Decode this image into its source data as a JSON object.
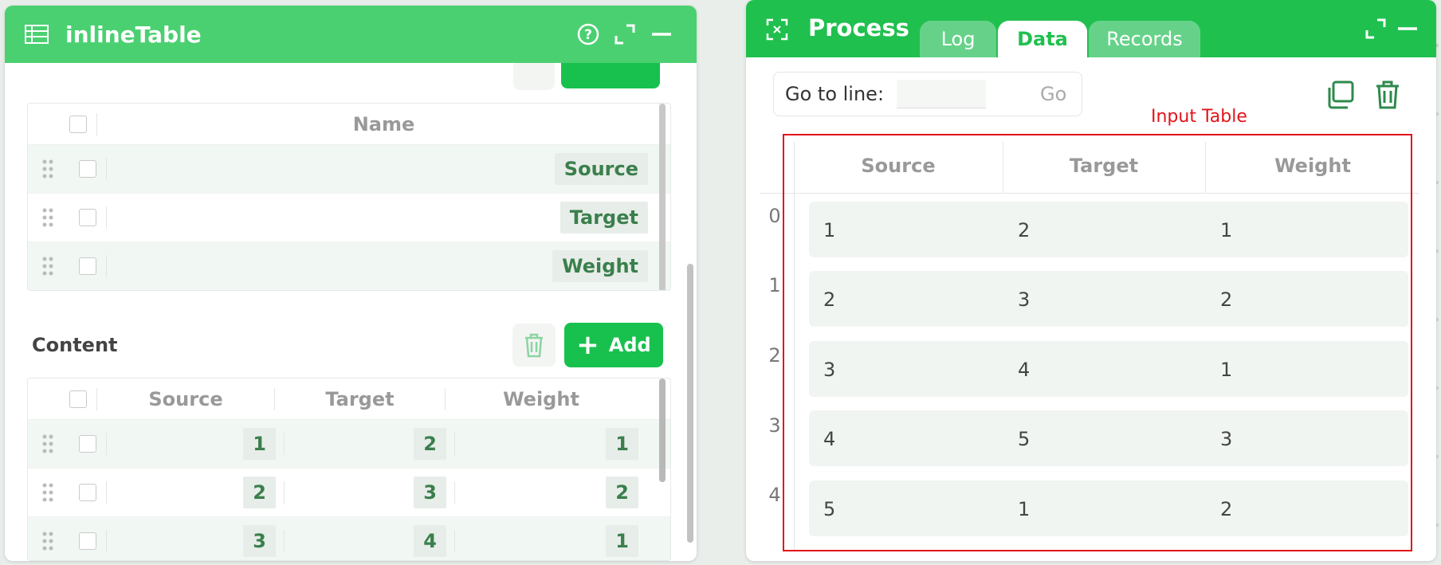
{
  "left_panel": {
    "title": "inlineTable",
    "colors": {
      "header_bg": "#4bd071",
      "accent": "#18c14d"
    },
    "columns_list": {
      "header": "Name",
      "items": [
        "Source",
        "Target",
        "Weight"
      ]
    },
    "content": {
      "label": "Content",
      "add_label": "Add",
      "headers": [
        "Source",
        "Target",
        "Weight"
      ],
      "rows": [
        [
          "1",
          "2",
          "1"
        ],
        [
          "2",
          "3",
          "2"
        ],
        [
          "3",
          "4",
          "1"
        ]
      ]
    }
  },
  "right_panel": {
    "title": "Process",
    "colors": {
      "header_bg": "#20c04f",
      "annotation": "#e2141a"
    },
    "tabs": [
      "Log",
      "Data",
      "Records"
    ],
    "active_tab": "Data",
    "goto": {
      "label": "Go to line:",
      "go_label": "Go",
      "value": ""
    },
    "annotation_label": "Input Table",
    "table": {
      "headers": [
        "Source",
        "Target",
        "Weight"
      ],
      "index": [
        "0",
        "1",
        "2",
        "3",
        "4"
      ],
      "rows": [
        [
          "1",
          "2",
          "1"
        ],
        [
          "2",
          "3",
          "2"
        ],
        [
          "3",
          "4",
          "1"
        ],
        [
          "4",
          "5",
          "3"
        ],
        [
          "5",
          "1",
          "2"
        ]
      ]
    }
  }
}
